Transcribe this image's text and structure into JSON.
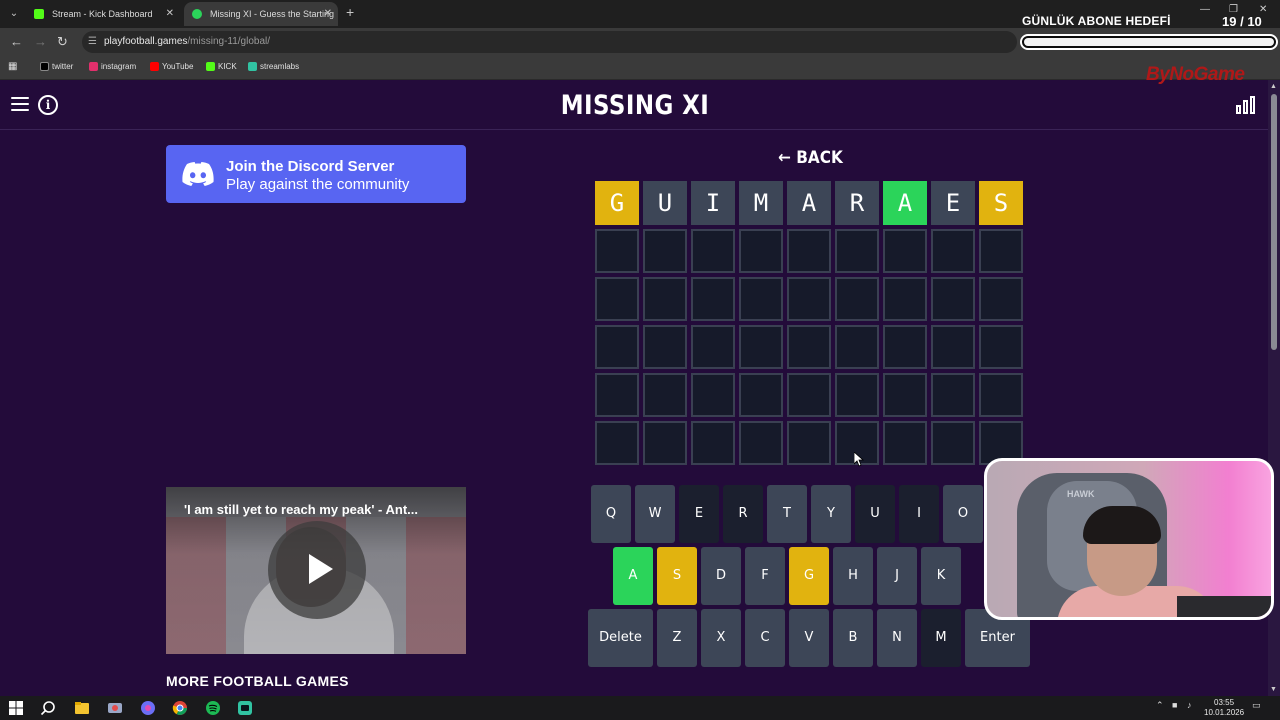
{
  "browser": {
    "tabs": [
      {
        "label": "Stream - Kick Dashboard",
        "fav_color": "#53fc18"
      },
      {
        "label": "Missing XI - Guess the Starting",
        "fav_color": "#2bd45a"
      }
    ],
    "url_host": "playfootball.games",
    "url_path": "/missing-11/global/",
    "bookmarks": [
      {
        "label": "twitter",
        "color": "#000000"
      },
      {
        "label": "instagram",
        "color": "#e1306c"
      },
      {
        "label": "YouTube",
        "color": "#ff0000"
      },
      {
        "label": "KICK",
        "color": "#53fc18"
      },
      {
        "label": "streamlabs",
        "color": "#31c3a2"
      }
    ]
  },
  "overlay": {
    "goal_title": "GÜNLÜK ABONE HEDEFİ",
    "count": "19",
    "target": "/ 10",
    "progress": 1.0,
    "brand": "ByNoGame"
  },
  "site": {
    "title": "MISSING XI",
    "discord_title": "Join the Discord Server",
    "discord_subtitle": "Play against the community",
    "video_title": "'I am still yet to reach my peak' - Ant...",
    "more_games": "MORE FOOTBALL GAMES"
  },
  "game": {
    "back_label": "BACK",
    "rows": 6,
    "cols": 9,
    "guess": [
      {
        "letter": "G",
        "state": "yellow"
      },
      {
        "letter": "U",
        "state": "gray"
      },
      {
        "letter": "I",
        "state": "gray"
      },
      {
        "letter": "M",
        "state": "gray"
      },
      {
        "letter": "A",
        "state": "gray"
      },
      {
        "letter": "R",
        "state": "gray"
      },
      {
        "letter": "A",
        "state": "green"
      },
      {
        "letter": "E",
        "state": "gray"
      },
      {
        "letter": "S",
        "state": "yellow"
      }
    ],
    "keyboard": {
      "row1": [
        {
          "k": "Q",
          "s": "plain"
        },
        {
          "k": "W",
          "s": "plain"
        },
        {
          "k": "E",
          "s": "dark"
        },
        {
          "k": "R",
          "s": "dark"
        },
        {
          "k": "T",
          "s": "plain"
        },
        {
          "k": "Y",
          "s": "plain"
        },
        {
          "k": "U",
          "s": "dark"
        },
        {
          "k": "I",
          "s": "dark"
        },
        {
          "k": "O",
          "s": "plain"
        }
      ],
      "row2": [
        {
          "k": "A",
          "s": "green"
        },
        {
          "k": "S",
          "s": "yellow"
        },
        {
          "k": "D",
          "s": "plain"
        },
        {
          "k": "F",
          "s": "plain"
        },
        {
          "k": "G",
          "s": "yellow"
        },
        {
          "k": "H",
          "s": "plain"
        },
        {
          "k": "J",
          "s": "plain"
        },
        {
          "k": "K",
          "s": "plain"
        }
      ],
      "row3": [
        {
          "k": "Delete",
          "s": "plain"
        },
        {
          "k": "Z",
          "s": "plain"
        },
        {
          "k": "X",
          "s": "plain"
        },
        {
          "k": "C",
          "s": "plain"
        },
        {
          "k": "V",
          "s": "plain"
        },
        {
          "k": "B",
          "s": "plain"
        },
        {
          "k": "N",
          "s": "plain"
        },
        {
          "k": "M",
          "s": "dark"
        },
        {
          "k": "Enter",
          "s": "plain"
        }
      ]
    }
  },
  "webcam": {
    "chair_brand": "HAWK"
  },
  "taskbar": {
    "time": "03:55",
    "date": "10.01.2026"
  }
}
